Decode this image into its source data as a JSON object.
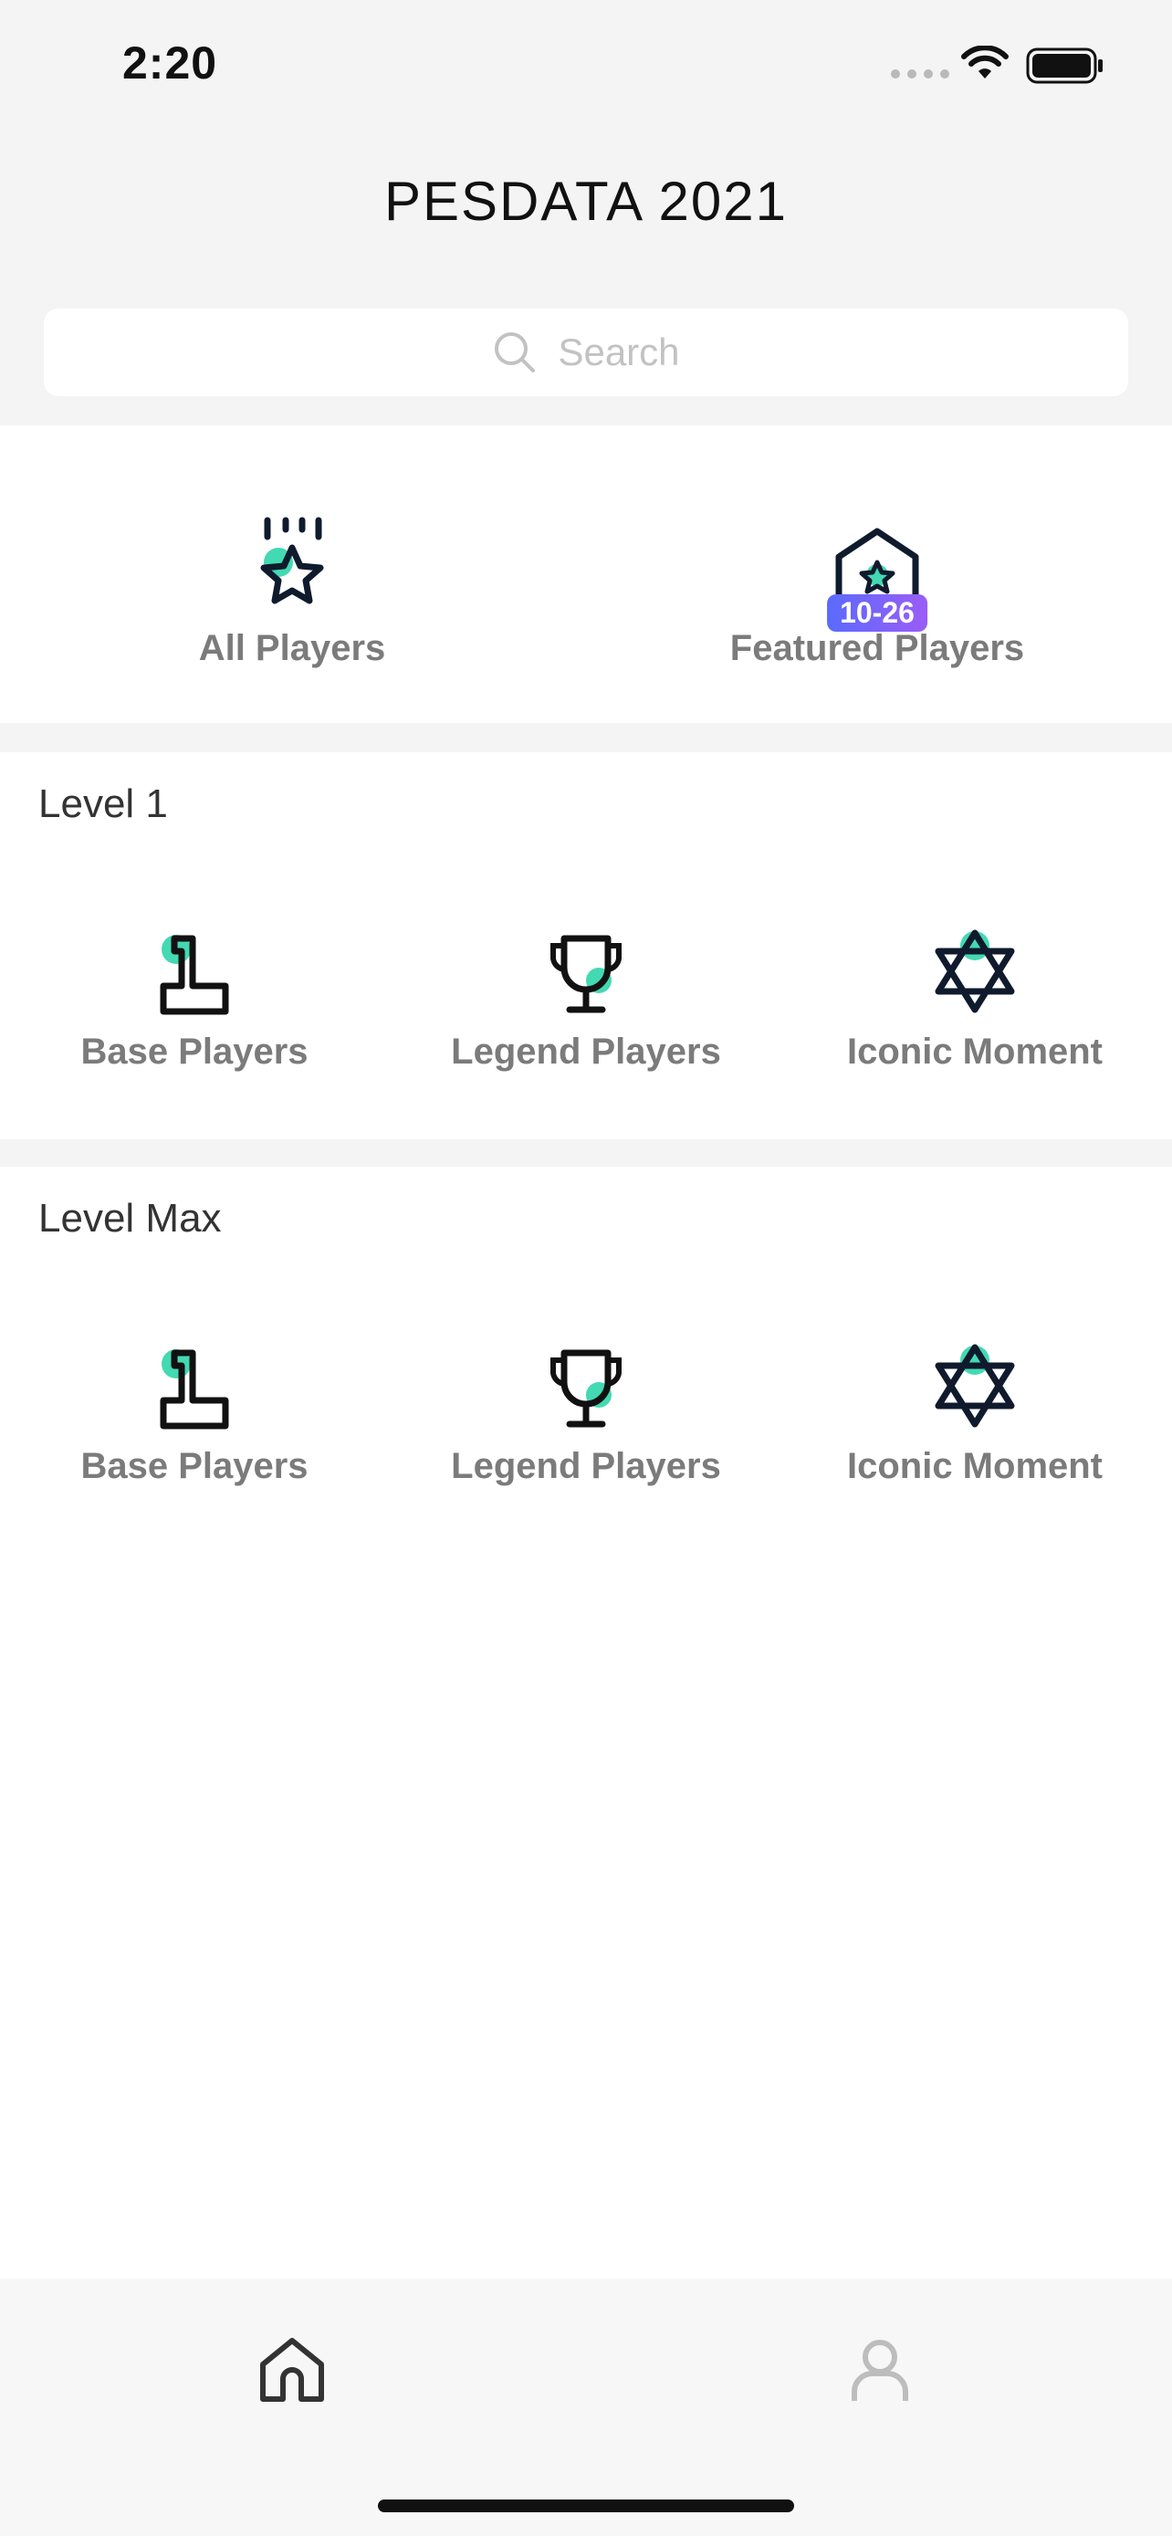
{
  "status_bar": {
    "time": "2:20"
  },
  "header": {
    "title": "PESDATA 2021"
  },
  "search": {
    "placeholder": "Search"
  },
  "categories": [
    {
      "label": "All Players",
      "icon": "star-award-icon"
    },
    {
      "label": "Featured Players",
      "icon": "featured-house-star-icon",
      "badge": "10-26"
    }
  ],
  "sections": [
    {
      "title": "Level 1",
      "items": [
        {
          "label": "Base Players",
          "icon": "podium-icon"
        },
        {
          "label": "Legend Players",
          "icon": "trophy-icon"
        },
        {
          "label": "Iconic Moment",
          "icon": "star-of-david-icon"
        }
      ]
    },
    {
      "title": "Level Max",
      "items": [
        {
          "label": "Base Players",
          "icon": "podium-icon"
        },
        {
          "label": "Legend Players",
          "icon": "trophy-icon"
        },
        {
          "label": "Iconic Moment",
          "icon": "star-of-david-icon"
        }
      ]
    }
  ],
  "tab_bar": {
    "tabs": [
      {
        "icon": "home-icon",
        "active": true
      },
      {
        "icon": "person-icon",
        "active": false
      }
    ]
  },
  "colors": {
    "accent": "#43d9b2",
    "icon_dark": "#0f1b2d",
    "badge_start": "#5a6bff",
    "badge_end": "#9b5cf6"
  }
}
